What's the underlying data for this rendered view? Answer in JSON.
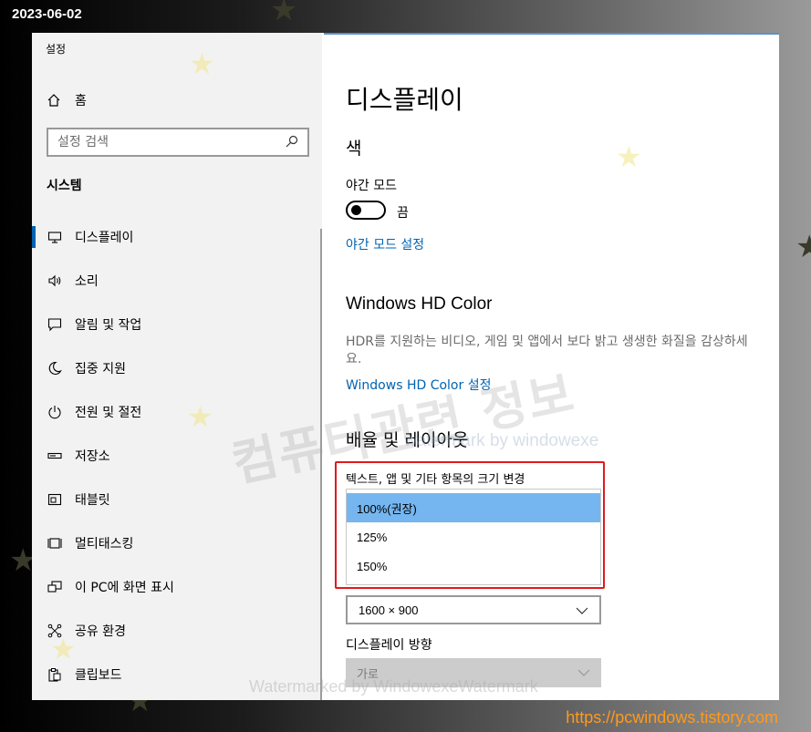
{
  "overlay": {
    "date": "2023-06-02",
    "site_url": "https://pcwindows.tistory.com",
    "watermark_korean": "컴퓨터관련 정보",
    "watermark_en": "watermark by windowexe",
    "watermark_bottom": "Watermarked by WindowexeWatermark"
  },
  "window": {
    "app_title": "설정"
  },
  "sidebar": {
    "home_label": "홈",
    "search_placeholder": "설정 검색",
    "section_title": "시스템",
    "items": [
      {
        "label": "디스플레이",
        "icon": "monitor-icon",
        "active": true
      },
      {
        "label": "소리",
        "icon": "speaker-icon"
      },
      {
        "label": "알림 및 작업",
        "icon": "notification-icon"
      },
      {
        "label": "집중 지원",
        "icon": "moon-icon"
      },
      {
        "label": "전원 및 절전",
        "icon": "power-icon"
      },
      {
        "label": "저장소",
        "icon": "storage-icon"
      },
      {
        "label": "태블릿",
        "icon": "tablet-icon"
      },
      {
        "label": "멀티태스킹",
        "icon": "multitasking-icon"
      },
      {
        "label": "이 PC에 화면 표시",
        "icon": "project-icon"
      },
      {
        "label": "공유 환경",
        "icon": "share-icon"
      },
      {
        "label": "클립보드",
        "icon": "clipboard-icon"
      }
    ]
  },
  "main": {
    "title": "디스플레이",
    "color_heading": "색",
    "night_mode_label": "야간 모드",
    "night_mode_state": "끔",
    "night_mode_link": "야간 모드 설정",
    "hdr_heading": "Windows HD Color",
    "hdr_description": "HDR를 지원하는 비디오, 게임 및 앱에서 보다 밝고 생생한 화질을 감상하세요.",
    "hdr_link": "Windows HD Color 설정",
    "scale_heading": "배율 및 레이아웃",
    "scale_label": "텍스트, 앱 및 기타 항목의 크기 변경",
    "scale_options": [
      "100%(권장)",
      "125%",
      "150%"
    ],
    "scale_selected_index": 0,
    "resolution_value": "1600 × 900",
    "orientation_label": "디스플레이 방향",
    "orientation_value": "가로"
  },
  "colors": {
    "accent": "#0063b1",
    "selected_option": "#75b6f0",
    "highlight_box": "#e0191e",
    "url": "#ff9a1c"
  }
}
